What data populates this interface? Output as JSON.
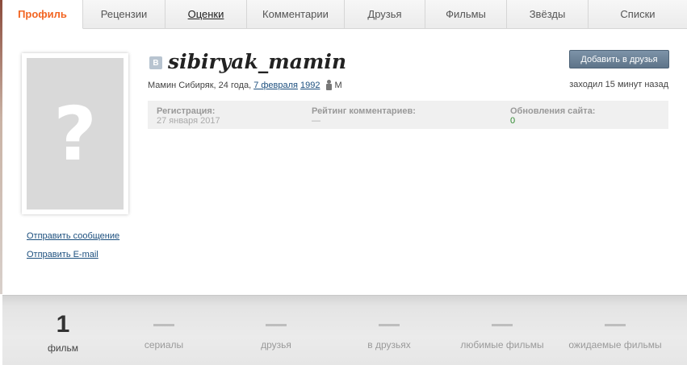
{
  "tabs": [
    {
      "label": "Профиль",
      "state": "active"
    },
    {
      "label": "Рецензии",
      "state": "normal"
    },
    {
      "label": "Оценки",
      "state": "underlined"
    },
    {
      "label": "Комментарии",
      "state": "normal"
    },
    {
      "label": "Друзья",
      "state": "normal"
    },
    {
      "label": "Фильмы",
      "state": "normal"
    },
    {
      "label": "Звёзды",
      "state": "normal"
    },
    {
      "label": "Списки",
      "state": "normal"
    }
  ],
  "avatar": {
    "placeholder_glyph": "?"
  },
  "sidebar": {
    "send_message": "Отправить сообщение",
    "send_email": "Отправить E-mail"
  },
  "profile": {
    "badge": "B",
    "username": "sibiryak_mamin",
    "name_age": "Мамин Сибиряк, 24 года,",
    "birth_day": "7 февраля",
    "birth_year": "1992",
    "gender": "М",
    "last_seen": "заходил 15 минут назад",
    "add_friend": "Добавить в друзья"
  },
  "stats": {
    "registration_label": "Регистрация:",
    "registration_value": "27 января 2017",
    "rating_label": "Рейтинг комментариев:",
    "rating_value": "—",
    "updates_label": "Обновления сайта:",
    "updates_value": "0"
  },
  "counters": [
    {
      "value": "1",
      "label": "фильм"
    },
    {
      "value": "",
      "label": "сериалы"
    },
    {
      "value": "",
      "label": "друзья"
    },
    {
      "value": "",
      "label": "в друзьях"
    },
    {
      "value": "",
      "label": "любимые фильмы"
    },
    {
      "value": "",
      "label": "ожидаемые фильмы"
    }
  ],
  "colors": {
    "accent": "#f26522",
    "link": "#1c4f7e",
    "button": "#6a8096"
  }
}
